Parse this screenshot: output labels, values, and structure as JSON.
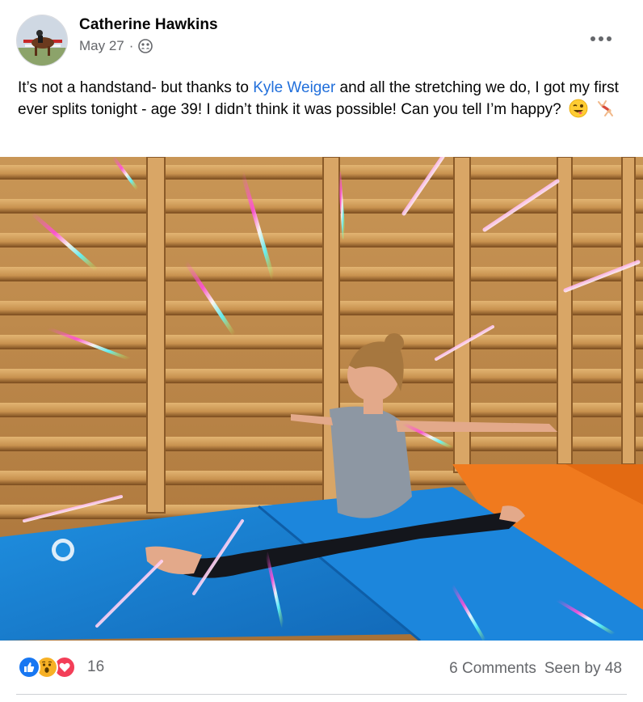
{
  "post": {
    "author": "Catherine Hawkins",
    "date": "May 27",
    "separator": "·",
    "audience_icon": "group-audience-icon",
    "text_before_link": "It’s not a handstand- but thanks to ",
    "mention": "Kyle Weiger",
    "text_after_link": " and all the stretching we do, I got my first ever splits tonight - age 39! I didn’t think it was possible! Can you tell I’m happy?",
    "emojis": [
      "winking-face-tongue-emoji",
      "person-cartwheeling-emoji"
    ],
    "photo_icon": "gymnastics-splits-photo"
  },
  "footer": {
    "reaction_icons": [
      "like-icon",
      "wow-icon",
      "love-icon"
    ],
    "reaction_count": "16",
    "comments": "6 Comments",
    "seen_by": "Seen by 48"
  },
  "colors": {
    "link": "#216fdb",
    "secondary_text": "#65676b",
    "like": "#1877f2",
    "love": "#f33e58",
    "wow": "#f7b125"
  }
}
